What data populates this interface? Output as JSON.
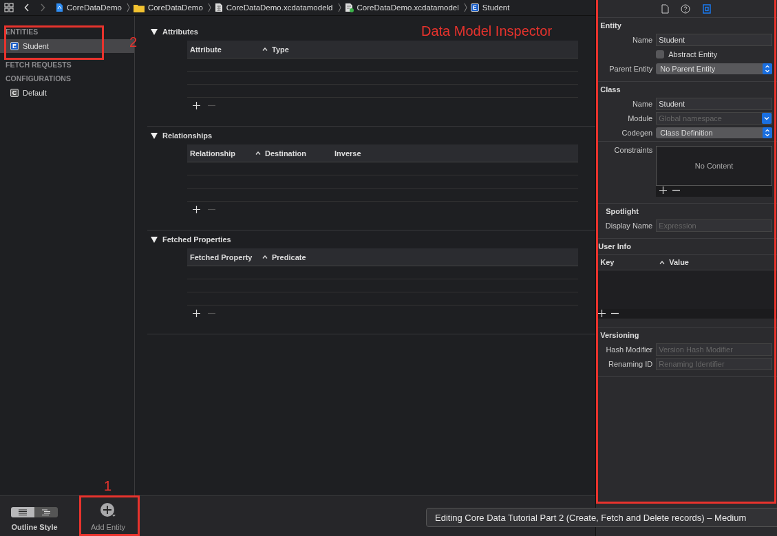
{
  "toolbar": {
    "breadcrumbs": [
      {
        "label": "CoreDataDemo",
        "kind": "project"
      },
      {
        "label": "CoreDataDemo",
        "kind": "folder"
      },
      {
        "label": "CoreDataDemo.xcdatamodeld",
        "kind": "model"
      },
      {
        "label": "CoreDataDemo.xcdatamodel",
        "kind": "modelfile"
      },
      {
        "label": "Student",
        "kind": "entity",
        "badge": "E"
      }
    ]
  },
  "sidebar": {
    "sections": [
      {
        "title": "ENTITIES",
        "items": [
          {
            "label": "Student",
            "badge": "E",
            "selected": true
          }
        ]
      },
      {
        "title": "FETCH REQUESTS"
      },
      {
        "title": "CONFIGURATIONS",
        "items": [
          {
            "label": "Default",
            "badge": "C",
            "selected": false
          }
        ]
      }
    ]
  },
  "editor": {
    "sections": [
      {
        "title": "Attributes",
        "expanded": true,
        "columns": [
          {
            "label": "Attribute",
            "sorted": false
          },
          {
            "label": "Type",
            "sorted": true
          }
        ]
      },
      {
        "title": "Relationships",
        "expanded": true,
        "columns": [
          {
            "label": "Relationship",
            "sorted": false
          },
          {
            "label": "Destination",
            "sorted": true
          },
          {
            "label": "Inverse",
            "sorted": false
          }
        ]
      },
      {
        "title": "Fetched Properties",
        "expanded": true,
        "columns": [
          {
            "label": "Fetched Property",
            "sorted": false
          },
          {
            "label": "Predicate",
            "sorted": true
          }
        ]
      }
    ]
  },
  "inspector": {
    "tabs": [
      {
        "kind": "file",
        "selected": false
      },
      {
        "kind": "help",
        "selected": false
      },
      {
        "kind": "model",
        "selected": true
      }
    ],
    "sections": [
      {
        "title": "Entity",
        "rows": [
          {
            "kind": "text",
            "label": "Name",
            "value": "Student"
          },
          {
            "kind": "checkbox",
            "label": "Abstract Entity",
            "checked": false
          },
          {
            "kind": "popup",
            "label": "Parent Entity",
            "value": "No Parent Entity"
          }
        ]
      },
      {
        "title": "Class",
        "rows": [
          {
            "kind": "text",
            "label": "Name",
            "value": "Student"
          },
          {
            "kind": "combo",
            "label": "Module",
            "placeholder": "Global namespace"
          },
          {
            "kind": "popup",
            "label": "Codegen",
            "value": "Class Definition"
          },
          {
            "kind": "list",
            "label": "Constraints",
            "empty_text": "No Content"
          }
        ]
      },
      {
        "title": "Spotlight",
        "rows": [
          {
            "kind": "text",
            "label": "Display Name",
            "placeholder": "Expression"
          }
        ]
      },
      {
        "title": "User Info",
        "kind": "table",
        "columns": [
          {
            "label": "Key",
            "sorted": false
          },
          {
            "label": "Value",
            "sorted": true
          }
        ]
      },
      {
        "title": "Versioning",
        "rows": [
          {
            "kind": "text",
            "label": "Hash Modifier",
            "placeholder": "Version Hash Modifier"
          },
          {
            "kind": "text",
            "label": "Renaming ID",
            "placeholder": "Renaming Identifier"
          }
        ]
      }
    ]
  },
  "bottom_bar": {
    "outline_style": {
      "label": "Outline Style",
      "segments": [
        {
          "kind": "list",
          "selected": true
        },
        {
          "kind": "tree",
          "selected": false
        }
      ]
    },
    "add_entity": {
      "label": "Add Entity"
    }
  },
  "tooltip": {
    "text": "Editing Core Data Tutorial Part 2 (Create, Fetch and Delete records) – Medium"
  },
  "annotations": [
    {
      "text": "Data Model Inspector"
    },
    {
      "text": "2"
    },
    {
      "text": "1"
    }
  ]
}
